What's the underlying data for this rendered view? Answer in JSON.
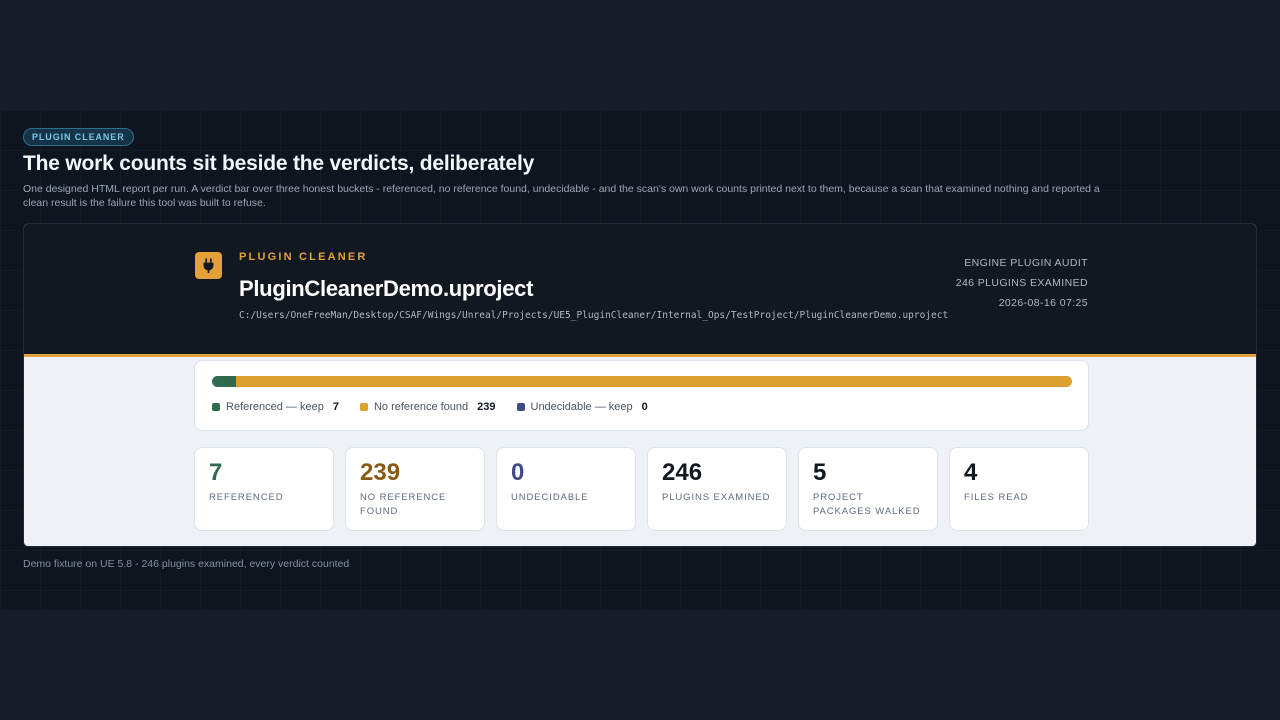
{
  "slide": {
    "eyebrow": "PLUGIN CLEANER",
    "headline": "The work counts sit beside the verdicts, deliberately",
    "subline": "One designed HTML report per run. A verdict bar over three honest buckets - referenced, no reference found, undecidable - and the scan's own work counts printed next to them, because a scan that examined nothing and reported a clean result is the failure this tool was built to refuse.",
    "footer": "Demo fixture on UE 5.8 - 246 plugins examined, every verdict counted"
  },
  "report": {
    "icon": "plug-icon",
    "brand": "PLUGIN CLEANER",
    "project": "PluginCleanerDemo.uproject",
    "path": "C:/Users/OneFreeMan/Desktop/CSAF/Wings/Unreal/Projects/UE5_PluginCleaner/Internal_Ops/TestProject/PluginCleanerDemo.uproject",
    "meta": {
      "audit": "ENGINE PLUGIN AUDIT",
      "examined": "246 PLUGINS EXAMINED",
      "timestamp": "2026-08-16 07:25"
    },
    "verdicts": [
      {
        "label": "Referenced — keep",
        "count": 7,
        "color": "#2f6b4f"
      },
      {
        "label": "No reference found",
        "count": 239,
        "color": "#dda030"
      },
      {
        "label": "Undecidable — keep",
        "count": 0,
        "color": "#3f4a86"
      }
    ],
    "stats": [
      {
        "value": "7",
        "label": "REFERENCED",
        "color": "#2f6b4f"
      },
      {
        "value": "239",
        "label": "NO REFERENCE FOUND",
        "color": "#8a5a12"
      },
      {
        "value": "0",
        "label": "UNDECIDABLE",
        "color": "#3f4a86"
      },
      {
        "value": "246",
        "label": "PLUGINS EXAMINED",
        "color": "#121820"
      },
      {
        "value": "5",
        "label": "PROJECT PACKAGES WALKED",
        "color": "#121820"
      },
      {
        "value": "4",
        "label": "FILES READ",
        "color": "#121820"
      }
    ]
  }
}
